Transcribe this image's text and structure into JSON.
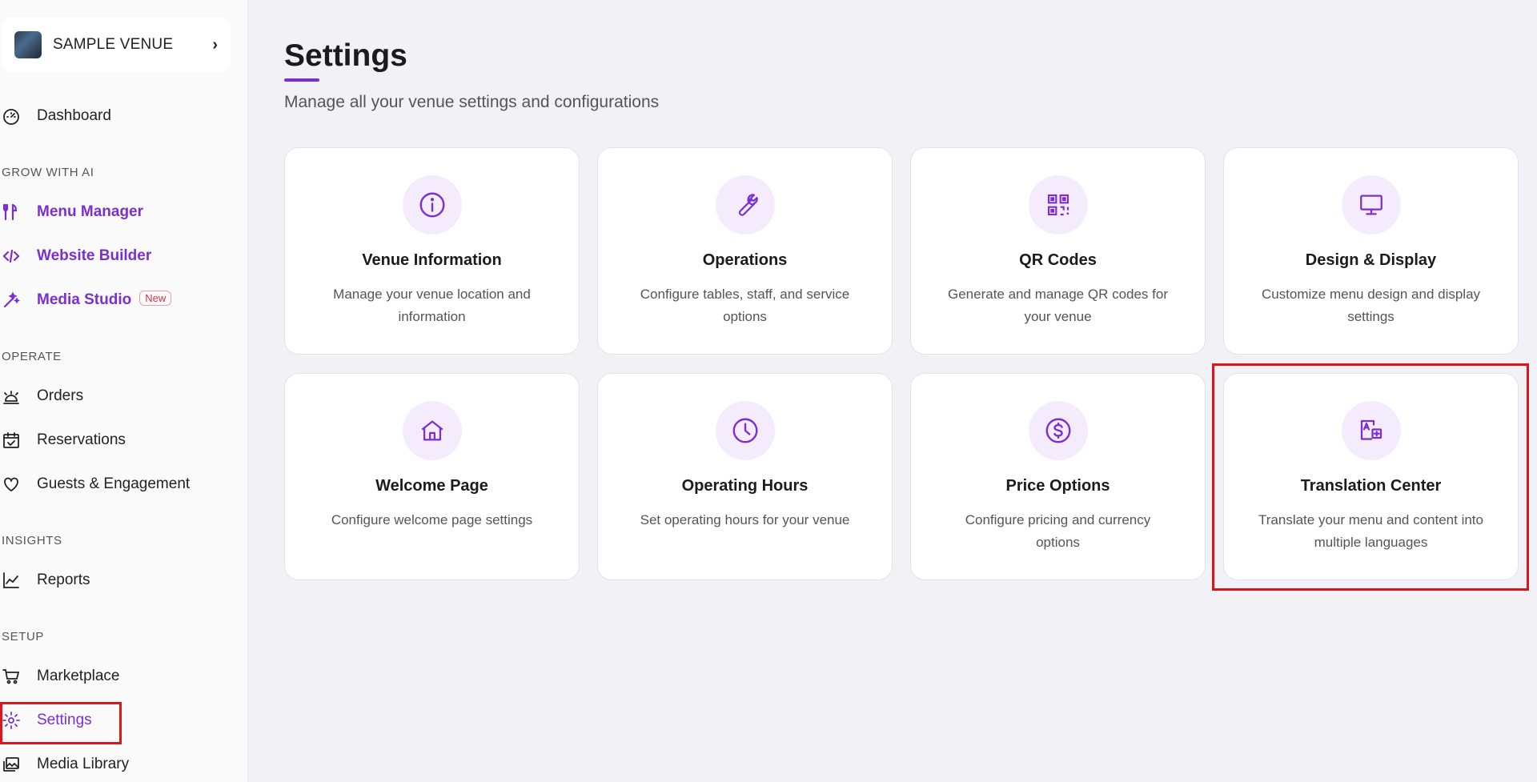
{
  "venue": {
    "name": "SAMPLE VENUE"
  },
  "sidebar": {
    "dashboard": "Dashboard",
    "sections": {
      "grow": "GROW WITH AI",
      "operate": "OPERATE",
      "insights": "INSIGHTS",
      "setup": "SETUP"
    },
    "items": {
      "menu_manager": "Menu Manager",
      "website_builder": "Website Builder",
      "media_studio": "Media Studio",
      "media_studio_badge": "New",
      "orders": "Orders",
      "reservations": "Reservations",
      "guests": "Guests & Engagement",
      "reports": "Reports",
      "marketplace": "Marketplace",
      "settings": "Settings",
      "media_library": "Media Library"
    }
  },
  "page": {
    "title": "Settings",
    "subtitle": "Manage all your venue settings and configurations"
  },
  "cards": [
    {
      "title": "Venue Information",
      "desc": "Manage your venue location and information",
      "icon": "info-icon"
    },
    {
      "title": "Operations",
      "desc": "Configure tables, staff, and service options",
      "icon": "wrench-icon"
    },
    {
      "title": "QR Codes",
      "desc": "Generate and manage QR codes for your venue",
      "icon": "qr-code-icon"
    },
    {
      "title": "Design & Display",
      "desc": "Customize menu design and display settings",
      "icon": "monitor-icon"
    },
    {
      "title": "Welcome Page",
      "desc": "Configure welcome page settings",
      "icon": "home-icon"
    },
    {
      "title": "Operating Hours",
      "desc": "Set operating hours for your venue",
      "icon": "clock-icon"
    },
    {
      "title": "Price Options",
      "desc": "Configure pricing and currency options",
      "icon": "dollar-icon"
    },
    {
      "title": "Translation Center",
      "desc": "Translate your menu and content into multiple languages",
      "icon": "translate-icon"
    }
  ],
  "colors": {
    "accent": "#7b2fd1",
    "highlight": "#e0141e",
    "icon_bg": "#f4ecfd"
  }
}
